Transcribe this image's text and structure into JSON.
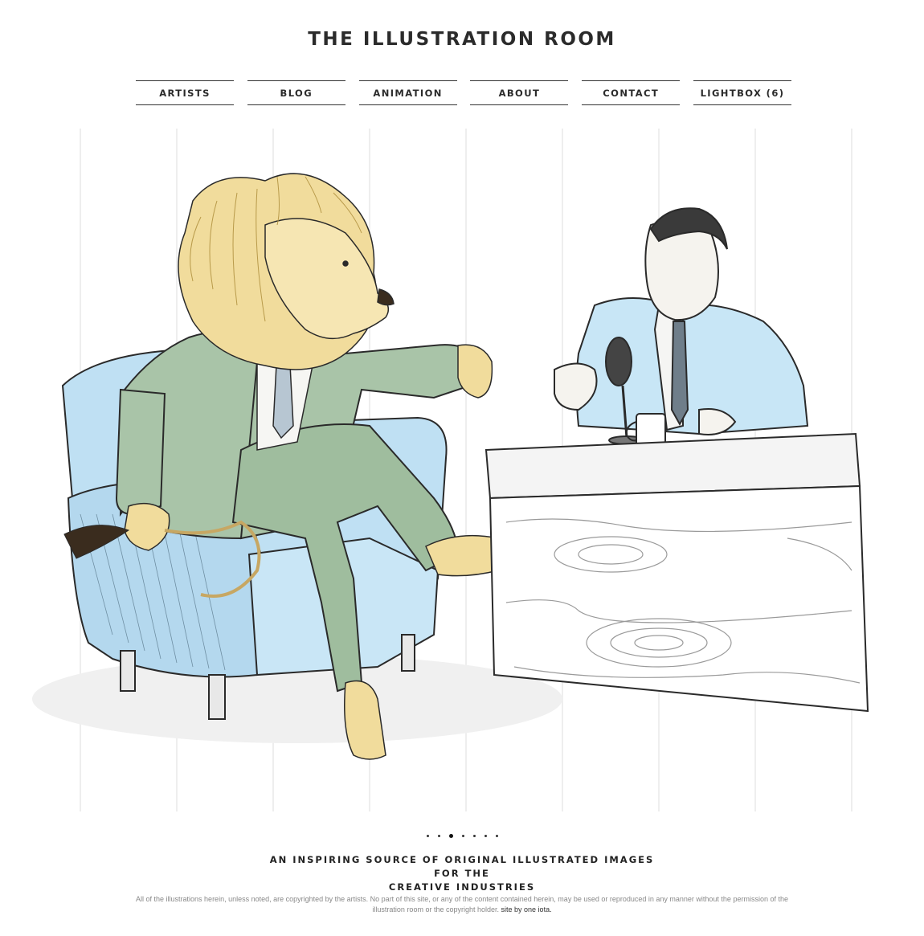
{
  "site": {
    "title": "THE ILLUSTRATION ROOM"
  },
  "nav": {
    "items": [
      {
        "label": "ARTISTS"
      },
      {
        "label": "BLOG"
      },
      {
        "label": "ANIMATION"
      },
      {
        "label": "ABOUT"
      },
      {
        "label": "CONTACT"
      },
      {
        "label": "LIGHTBOX (6)"
      }
    ]
  },
  "slideshow": {
    "slide_count": 7,
    "active_index": 2
  },
  "tagline": {
    "line1": "AN INSPIRING SOURCE OF ORIGINAL ILLUSTRATED IMAGES FOR THE",
    "line2": "CREATIVE INDUSTRIES"
  },
  "footer": {
    "copyright_text": "All of the illustrations herein, unless noted, are copyrighted by the artists. No part of this site, or any of the content contained herein, may be used or reproduced in any manner without the permission of the illustration room or the copyright holder.",
    "credit_link": "site by one iota."
  },
  "colors": {
    "text": "#222222",
    "footer_text": "#888888",
    "suit_green": "#a9c4a8",
    "chair_blue": "#bfe0f3",
    "mane_yellow": "#f1dc9c",
    "host_suit_blue": "#c8e6f6"
  }
}
